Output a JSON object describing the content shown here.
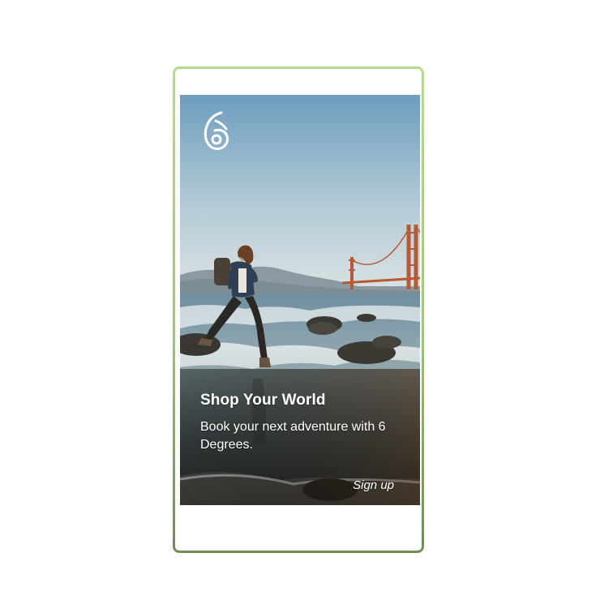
{
  "welcome": {
    "headline": "Shop Your World",
    "subline": "Book your next adventure with 6 Degrees.",
    "signup_label": "Sign up",
    "logo_icon": "six-degrees-logo-icon"
  },
  "colors": {
    "frame_top": "#b7d98c",
    "frame_bottom": "#6f8b56",
    "sky_top": "#7aa6c4",
    "sky_bottom": "#d8e2e6",
    "bridge": "#c0613c",
    "text": "#ffffff"
  }
}
